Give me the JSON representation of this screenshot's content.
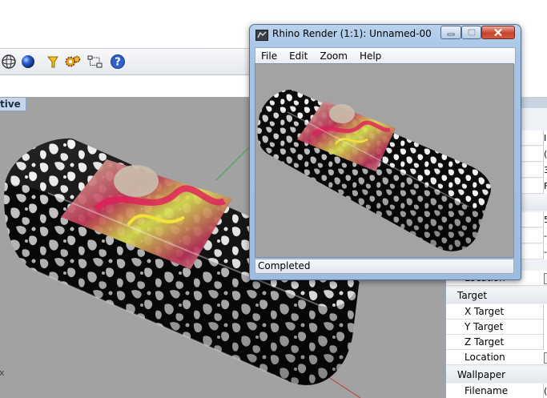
{
  "viewport": {
    "label": "tive",
    "axis_label": "x"
  },
  "toolbar": {
    "icons": [
      "sphere-outline-icon",
      "blue-sphere-icon",
      "flashlight-icon",
      "gears-icon",
      "layout-icon",
      "help-icon"
    ]
  },
  "properties": {
    "camera_location_label": "Location",
    "target_header": "Target",
    "x_target": "X Target",
    "y_target": "Y Target",
    "z_target": "Z Target",
    "location": "Location",
    "wallpaper_header": "Wallpaper",
    "filename": "Filename",
    "filename_value": "(",
    "right_column_values": [
      "I",
      "(",
      "3",
      "F",
      "5",
      "-",
      "-"
    ]
  },
  "render_window": {
    "title": "Rhino Render (1:1): Unnamed-00",
    "menu": {
      "file": "File",
      "edit": "Edit",
      "zoom": "Zoom",
      "help": "Help"
    },
    "status": "Completed"
  },
  "colors": {
    "viewport_bg": "#a2a2a2",
    "active_tab": "#c6d6ea",
    "axis_green": "#3aa64a",
    "axis_red": "#c43a3a",
    "window_frame": "#a6c3e4"
  }
}
